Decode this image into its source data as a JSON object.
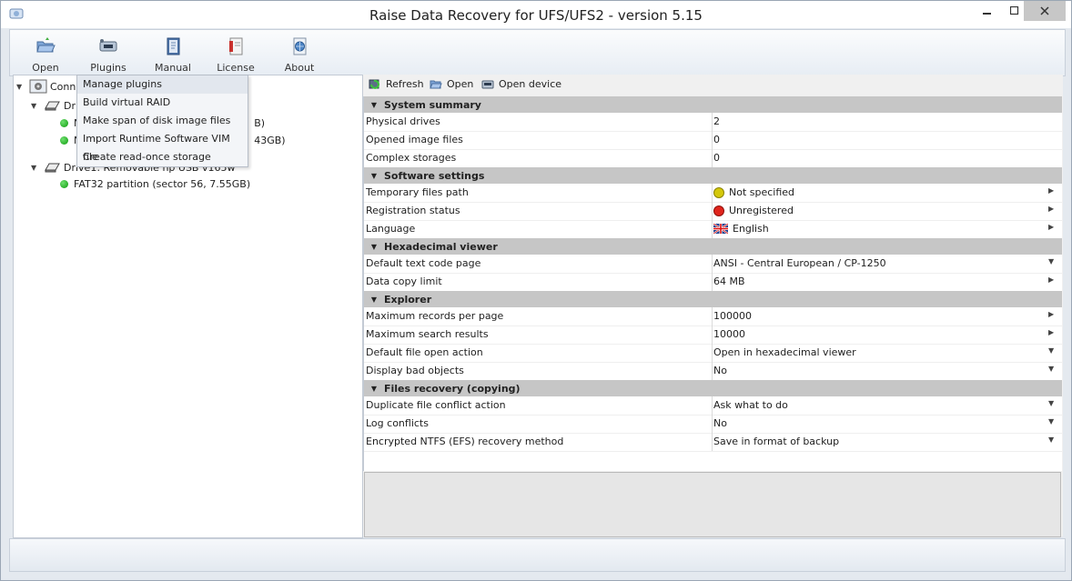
{
  "window": {
    "title": "Raise Data Recovery for UFS/UFS2 - version 5.15",
    "close_color": "#c7c7c7"
  },
  "toolbar": {
    "items": [
      {
        "label": "Open",
        "icon": "open-folder-icon"
      },
      {
        "label": "Plugins",
        "icon": "plugins-icon"
      },
      {
        "label": "Manual",
        "icon": "manual-book-icon"
      },
      {
        "label": "License",
        "icon": "license-icon"
      },
      {
        "label": "About",
        "icon": "about-globe-icon"
      }
    ]
  },
  "tree": {
    "nodes": [
      {
        "label": "Conne",
        "level": 0
      },
      {
        "label": "Dr",
        "level": 1
      },
      {
        "label": "N",
        "suffix": "B)",
        "level": 2
      },
      {
        "label": "N",
        "suffix": "43GB)",
        "level": 2
      },
      {
        "label": "Drive1: Removable hp USB v165w",
        "level": 1
      },
      {
        "label": "FAT32 partition (sector 56, 7.55GB)",
        "level": 2
      }
    ]
  },
  "plugins_menu": {
    "items": [
      "Manage plugins",
      "Build virtual RAID",
      "Make span of disk image files",
      "Import Runtime Software VIM file",
      "Create read-once storage"
    ]
  },
  "right_toolbar": {
    "refresh": "Refresh",
    "open": "Open",
    "open_device": "Open device"
  },
  "properties": {
    "sections": [
      {
        "title": "System summary",
        "rows": [
          {
            "name": "Physical drives",
            "value": "2"
          },
          {
            "name": "Opened image files",
            "value": "0"
          },
          {
            "name": "Complex storages",
            "value": "0"
          }
        ]
      },
      {
        "title": "Software settings",
        "rows": [
          {
            "name": "Temporary files path",
            "value": "Not specified",
            "status_color": "#d4c80a",
            "control": "arrow"
          },
          {
            "name": "Registration status",
            "value": "Unregistered",
            "status_color": "#e0241c",
            "control": "arrow"
          },
          {
            "name": "Language",
            "value": "English",
            "icon": "uk-flag-icon",
            "control": "arrow"
          }
        ]
      },
      {
        "title": "Hexadecimal viewer",
        "rows": [
          {
            "name": "Default text code page",
            "value": "ANSI - Central European / CP-1250",
            "control": "dropdown"
          },
          {
            "name": "Data copy limit",
            "value": "64 MB",
            "control": "arrow"
          }
        ]
      },
      {
        "title": "Explorer",
        "rows": [
          {
            "name": "Maximum records per page",
            "value": "100000",
            "control": "arrow"
          },
          {
            "name": "Maximum search results",
            "value": "10000",
            "control": "arrow"
          },
          {
            "name": "Default file open action",
            "value": "Open in hexadecimal viewer",
            "control": "dropdown"
          },
          {
            "name": "Display bad objects",
            "value": "No",
            "control": "dropdown"
          }
        ]
      },
      {
        "title": "Files recovery (copying)",
        "rows": [
          {
            "name": "Duplicate file conflict action",
            "value": "Ask what to do",
            "control": "dropdown"
          },
          {
            "name": "Log conflicts",
            "value": "No",
            "control": "dropdown"
          },
          {
            "name": "Encrypted NTFS (EFS) recovery method",
            "value": "Save in format of backup",
            "control": "dropdown"
          }
        ]
      }
    ]
  }
}
